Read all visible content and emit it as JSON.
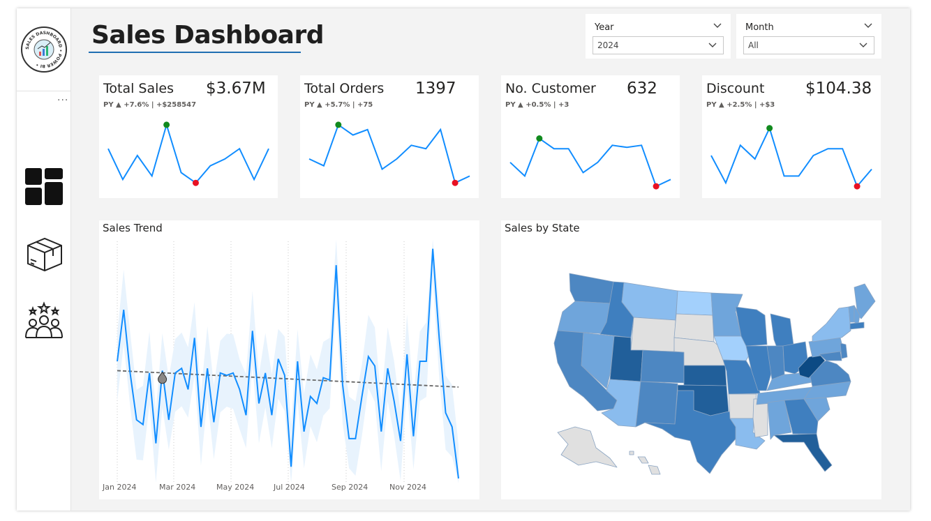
{
  "dashboard": {
    "title": "Sales Dashboard"
  },
  "sidebar": {
    "logo_text": "SALES DASHBOARD • POWER BI •",
    "more_label": "···",
    "nav": [
      {
        "name": "dashboard",
        "icon": "dashboard-grid-icon"
      },
      {
        "name": "products",
        "icon": "box-icon"
      },
      {
        "name": "customers",
        "icon": "customers-group-icon"
      }
    ]
  },
  "slicers": {
    "year": {
      "label": "Year",
      "value": "2024"
    },
    "month": {
      "label": "Month",
      "value": "All"
    }
  },
  "cards": [
    {
      "label": "Total Sales",
      "value": "$3.67M",
      "sub": "PY ▲ +7.6%  | +$258547",
      "spark": [
        0.6,
        0.15,
        0.5,
        0.2,
        0.95,
        0.25,
        0.1,
        0.35,
        0.45,
        0.6,
        0.15,
        0.6
      ],
      "max_index": 4,
      "min_index": 6
    },
    {
      "label": "Total Orders",
      "value": "1397",
      "sub": "PY ▲ +5.7%  | +75",
      "spark": [
        0.45,
        0.35,
        0.95,
        0.8,
        0.88,
        0.3,
        0.45,
        0.65,
        0.6,
        0.88,
        0.1,
        0.2
      ],
      "max_index": 2,
      "min_index": 10
    },
    {
      "label": "No. Customer",
      "value": "632",
      "sub": "PY ▲ +0.5%  | +3",
      "spark": [
        0.4,
        0.2,
        0.75,
        0.6,
        0.6,
        0.25,
        0.4,
        0.65,
        0.62,
        0.65,
        0.05,
        0.15
      ],
      "max_index": 2,
      "min_index": 10
    },
    {
      "label": "Discount",
      "value": "$104.38",
      "sub": "PY ▲ +2.5%  | +$3",
      "spark": [
        0.5,
        0.1,
        0.65,
        0.45,
        0.9,
        0.2,
        0.2,
        0.5,
        0.6,
        0.6,
        0.05,
        0.3
      ],
      "max_index": 4,
      "min_index": 10
    }
  ],
  "sales_trend": {
    "title": "Sales Trend",
    "x_labels": [
      "Jan 2024",
      "Mar 2024",
      "May 2024",
      "Jul 2024",
      "Sep 2024",
      "Nov 2024"
    ],
    "line_color": "#118dff",
    "band_color": "#e8f3fd",
    "trend_color": "#666666"
  },
  "map": {
    "title": "Sales by State",
    "colors": {
      "darkest": "#0c4a84",
      "dark": "#215f9a",
      "medium": "#3f7fbf",
      "mid": "#4d87c2",
      "light": "#6fa5db",
      "lighter": "#8abcee",
      "lightest": "#a3d0fc",
      "none": "#e0e0e0"
    }
  },
  "chart_data": [
    {
      "type": "line",
      "title": "Sales Trend",
      "x": [
        "Jan 2024",
        "Mar 2024",
        "May 2024",
        "Jul 2024",
        "Sep 2024",
        "Nov 2024"
      ],
      "series": [
        {
          "values": [
            0.5,
            0.72,
            0.45,
            0.25,
            0.23,
            0.45,
            0.15,
            0.46,
            0.25,
            0.45,
            0.47,
            0.38,
            0.6,
            0.22,
            0.47,
            0.24,
            0.45,
            0.44,
            0.45,
            0.38,
            0.27,
            0.63,
            0.32,
            0.45,
            0.27,
            0.51,
            0.44,
            0.05,
            0.5,
            0.2,
            0.35,
            0.32,
            0.43,
            0.42,
            0.91,
            0.4,
            0.17,
            0.17,
            0.35,
            0.52,
            0.48,
            0.2,
            0.47,
            0.33,
            0.16,
            0.53,
            0.18,
            0.5,
            0.5,
            0.98,
            0.6,
            0.28,
            0.22,
            0.0
          ]
        }
      ],
      "trend_line": [
        0.46,
        0.39
      ]
    }
  ]
}
